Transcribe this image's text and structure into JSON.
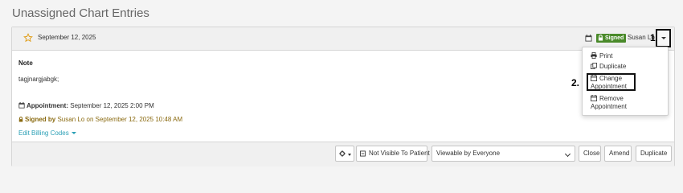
{
  "page": {
    "title": "Unassigned Chart Entries"
  },
  "entry": {
    "date": "September 12, 2025",
    "status_badge": "Signed",
    "author": "Susan Lo",
    "note_label": "Note",
    "note_text": "tagjnargjabgk;",
    "appointment_label": "Appointment:",
    "appointment_value": "September 12, 2025 2:00 PM",
    "signed_by_label": "Signed by",
    "signed_by_value": "Susan Lo on September 12, 2025 10:48 AM",
    "billing_link": "Edit Billing Codes"
  },
  "dropdown_menu": {
    "items": [
      {
        "label": "Print",
        "icon": "print-icon"
      },
      {
        "label": "Duplicate",
        "icon": "copy-icon"
      },
      {
        "label_line1": "Change",
        "label_line2": "Appointment",
        "icon": "calendar-icon"
      },
      {
        "label_line1": "Remove",
        "label_line2": "Appointment",
        "icon": "calendar-icon"
      }
    ]
  },
  "footer": {
    "visibility_button": "Not Visible To Patient",
    "viewable_select": "Viewable by Everyone",
    "close_button": "Close",
    "amend_button": "Amend",
    "duplicate_button": "Duplicate"
  },
  "annotations": {
    "marker_1": "1.",
    "marker_2": "2."
  },
  "colors": {
    "signed_badge": "#4a8a2a",
    "signed_by_text": "#8a6a10",
    "link": "#2a9fb5",
    "star": "#e0a020"
  }
}
